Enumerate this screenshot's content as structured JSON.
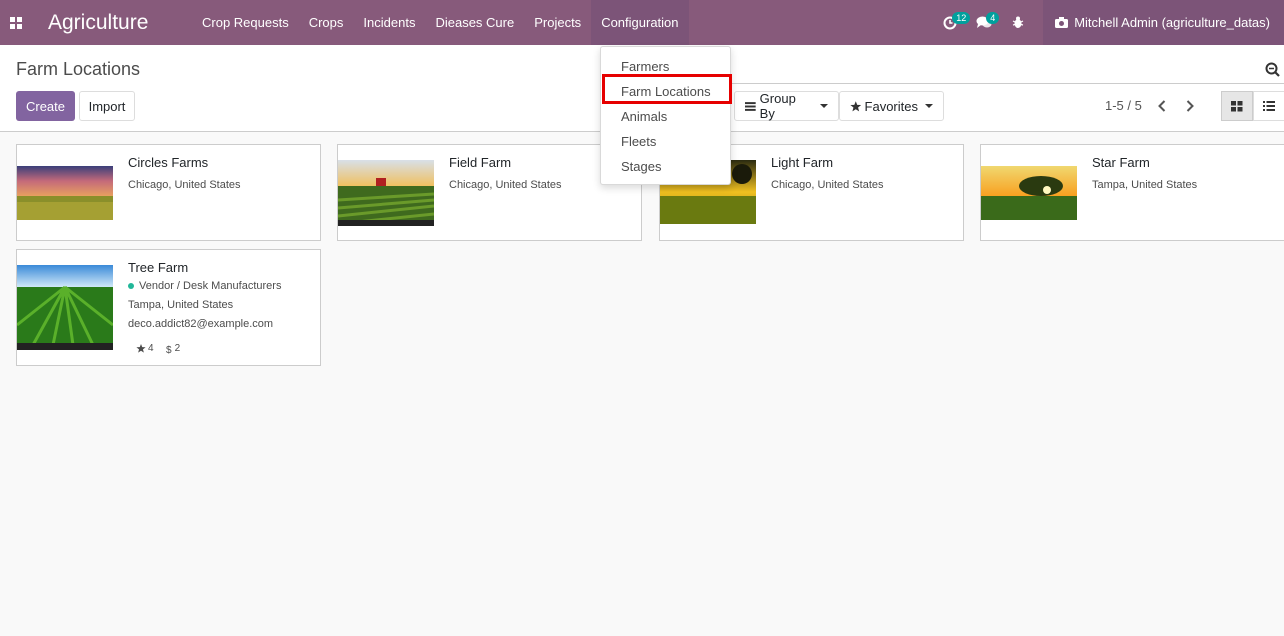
{
  "navbar": {
    "brand": "Agriculture",
    "menu": [
      "Crop Requests",
      "Crops",
      "Incidents",
      "Dieases Cure",
      "Projects",
      "Configuration"
    ],
    "activities_badge": "12",
    "messages_badge": "4",
    "user": "Mitchell Admin (agriculture_datas)"
  },
  "control_panel": {
    "title": "Farm Locations",
    "create_label": "Create",
    "import_label": "Import",
    "group_by_label": "Group By",
    "favorites_label": "Favorites",
    "pager": "1-5 / 5"
  },
  "dropdown": {
    "items": [
      "Farmers",
      "Farm Locations",
      "Animals",
      "Fleets",
      "Stages"
    ]
  },
  "cards": [
    {
      "name": "Circles Farms",
      "location": "Chicago, United States"
    },
    {
      "name": "Field Farm",
      "location": "Chicago, United States"
    },
    {
      "name": "Light Farm",
      "location": "Chicago, United States"
    },
    {
      "name": "Star Farm",
      "location": "Tampa, United States"
    },
    {
      "name": "Tree Farm",
      "category": "Vendor / Desk Manufacturers",
      "location": "Tampa, United States",
      "email": "deco.addict82@example.com",
      "stars": "4",
      "dollars": "2"
    }
  ],
  "colors": {
    "navbar": "#875a7b",
    "primary_button": "#7c6b9a",
    "highlight": "#e60000"
  }
}
